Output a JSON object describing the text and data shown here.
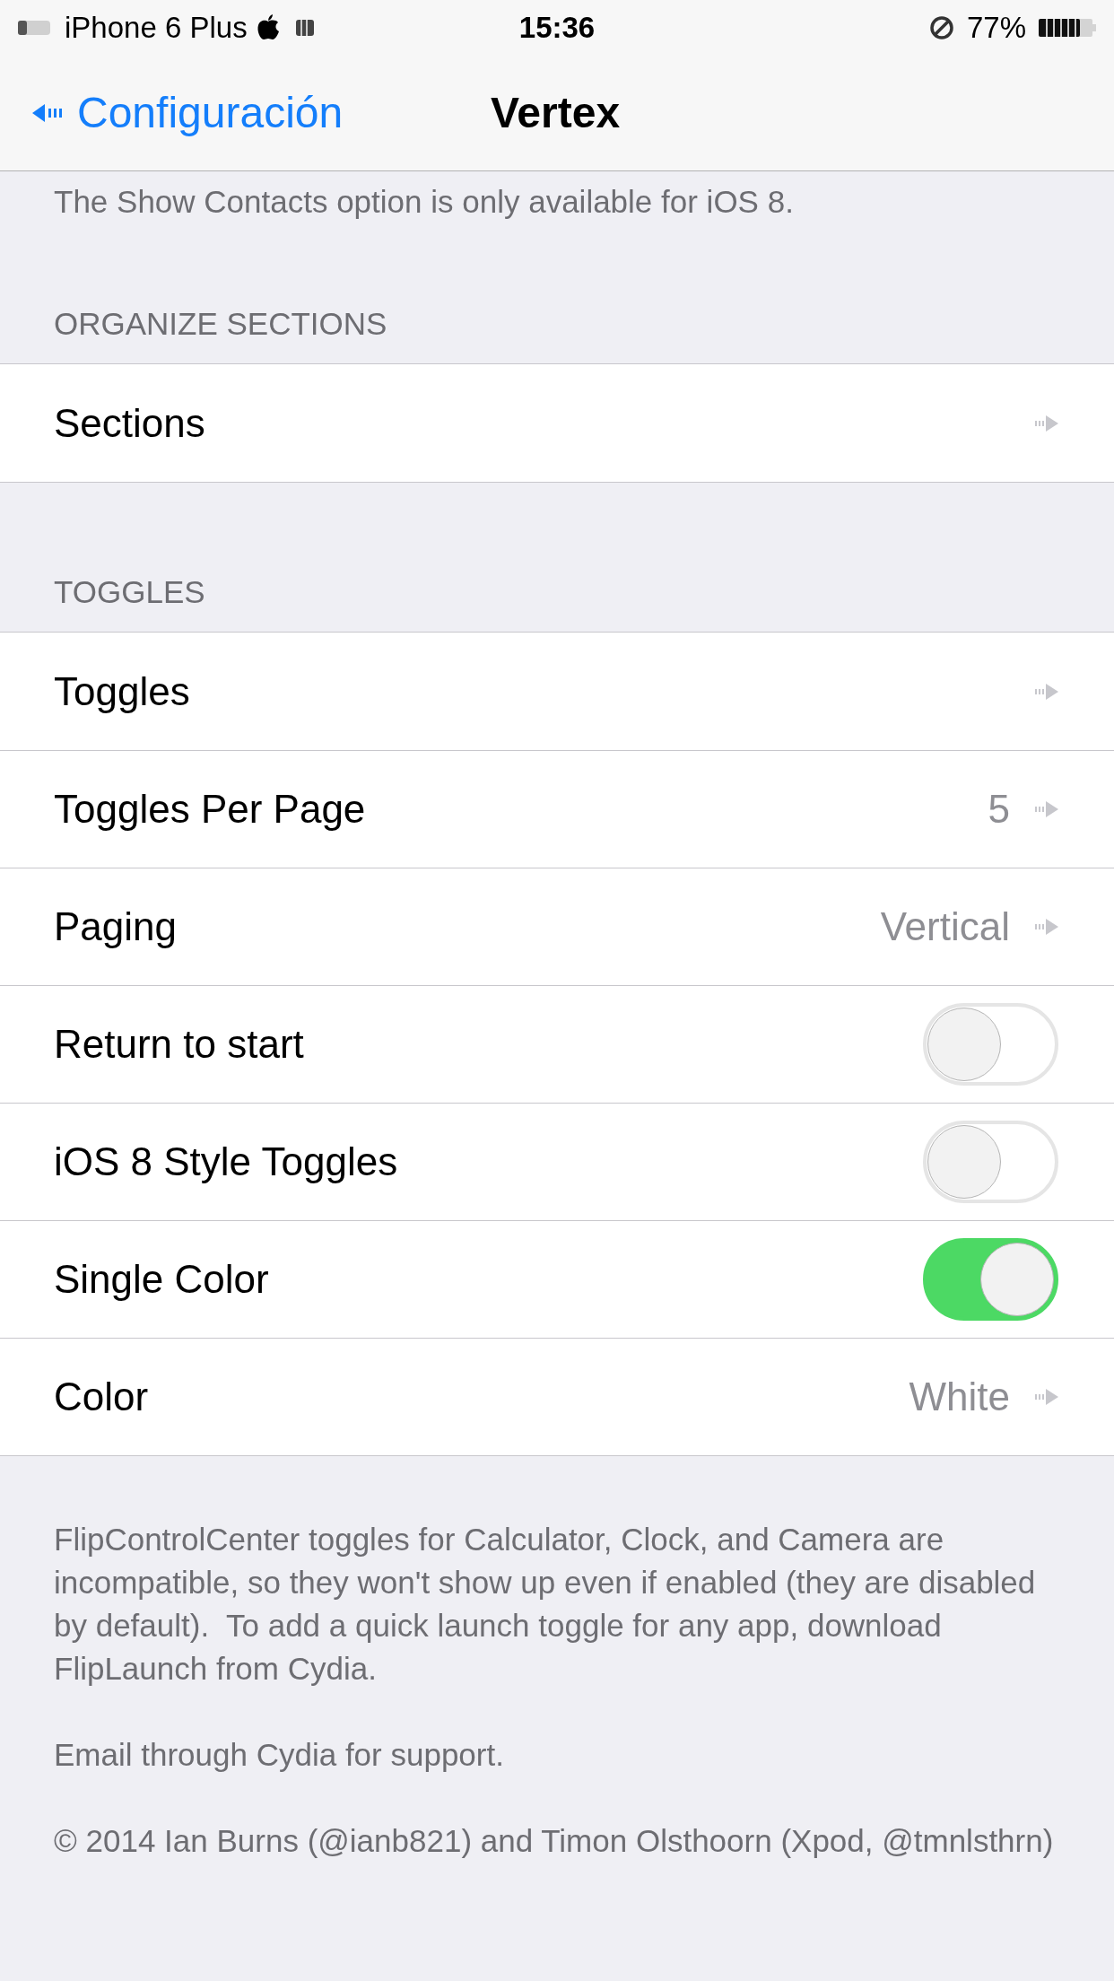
{
  "status_bar": {
    "carrier": "iPhone 6 Plus",
    "time": "15:36",
    "battery": "77%"
  },
  "nav": {
    "back": "Configuración",
    "title": "Vertex"
  },
  "top_note": "The Show Contacts option is only available for iOS 8.",
  "sections": [
    {
      "header": "ORGANIZE SECTIONS",
      "rows": [
        {
          "kind": "link",
          "label": "Sections"
        }
      ]
    },
    {
      "header": "TOGGLES",
      "rows": [
        {
          "kind": "link",
          "label": "Toggles"
        },
        {
          "kind": "link",
          "label": "Toggles Per Page",
          "value": "5"
        },
        {
          "kind": "link",
          "label": "Paging",
          "value": "Vertical"
        },
        {
          "kind": "switch",
          "label": "Return to start",
          "on": false
        },
        {
          "kind": "switch",
          "label": "iOS 8 Style Toggles",
          "on": false
        },
        {
          "kind": "switch",
          "label": "Single Color",
          "on": true
        },
        {
          "kind": "link",
          "label": "Color",
          "value": "White"
        }
      ]
    }
  ],
  "footer": [
    "FlipControlCenter toggles for Calculator, Clock, and Camera are incompatible, so they won't show up even if enabled (they are disabled by default).  To add a quick launch toggle for any app, download FlipLaunch from Cydia.",
    "Email through Cydia for support.",
    "© 2014 Ian Burns (@ianb821) and Timon Olsthoorn (Xpod, @tmnlsthrn)"
  ]
}
